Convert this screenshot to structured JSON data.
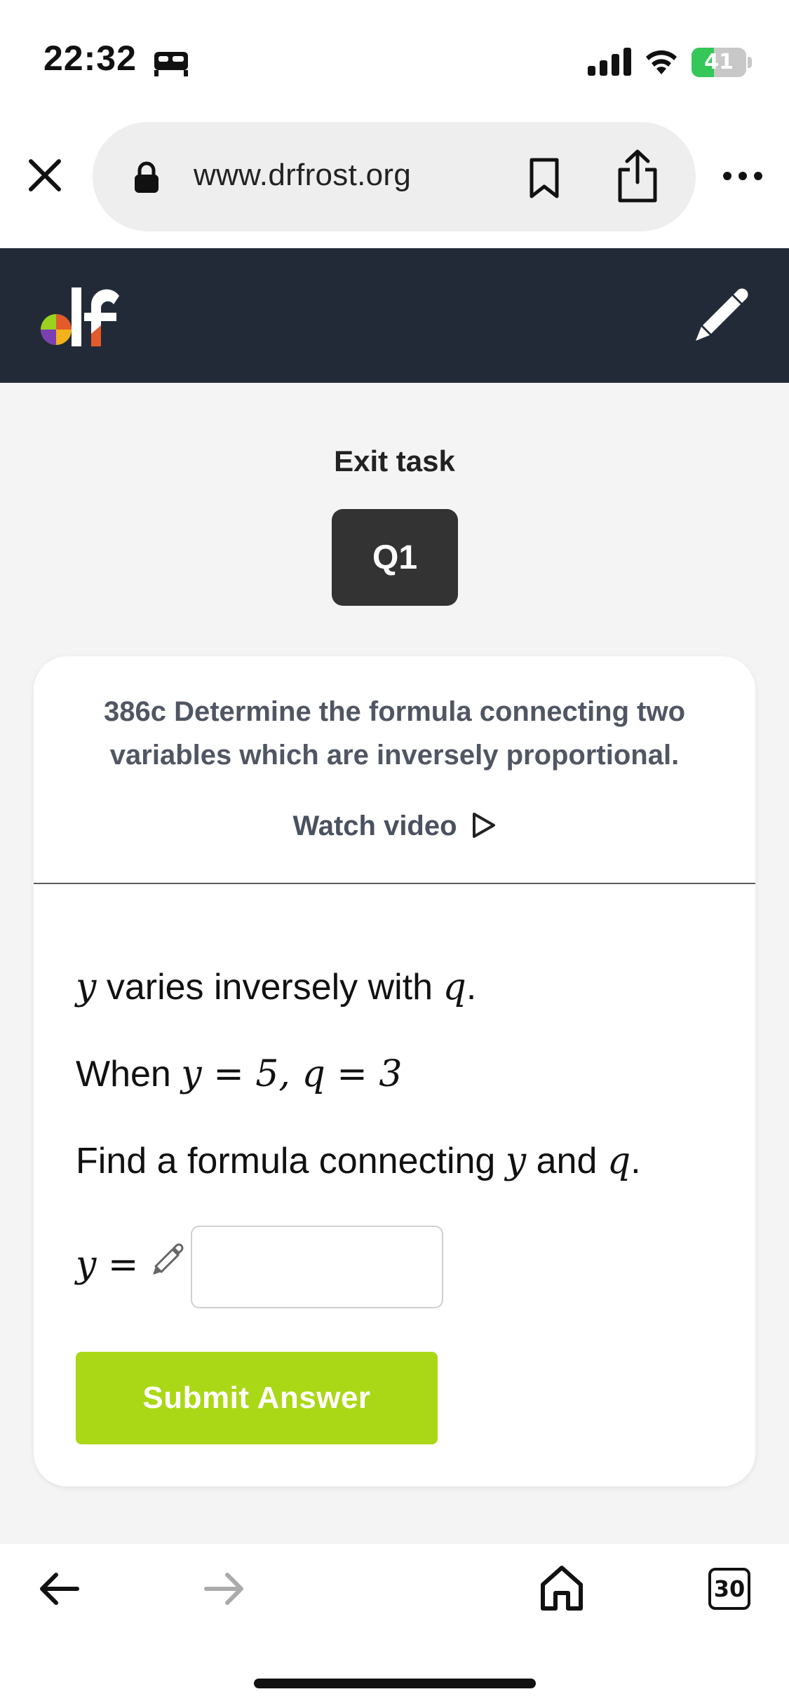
{
  "status_bar": {
    "time": "22:32",
    "battery_level": 41,
    "battery_text": "41"
  },
  "browser": {
    "url": "www.drfrost.org"
  },
  "page": {
    "exit_task": "Exit task",
    "question_badge": "Q1",
    "skill_title": "386c Determine the formula connecting two variables which are inversely proportional.",
    "watch_video": "Watch video",
    "question": {
      "line1": {
        "var1": "y",
        "text": " varies inversely with ",
        "var2": "q",
        "end": "."
      },
      "line2": {
        "text": "When ",
        "math": "y = 5, q = 3"
      },
      "line3": {
        "text": "Find a formula connecting ",
        "var1": "y",
        "mid": " and ",
        "var2": "q",
        "end": "."
      },
      "answer_prefix": "y ="
    },
    "answer_value": "",
    "submit_label": "Submit Answer"
  },
  "toolbar": {
    "tab_count": "30"
  },
  "colors": {
    "header_bg": "#232a37",
    "submit_green": "#abd816",
    "badge_bg": "#333333",
    "content_bg": "#f4f4f4",
    "title_gray": "#505663"
  }
}
